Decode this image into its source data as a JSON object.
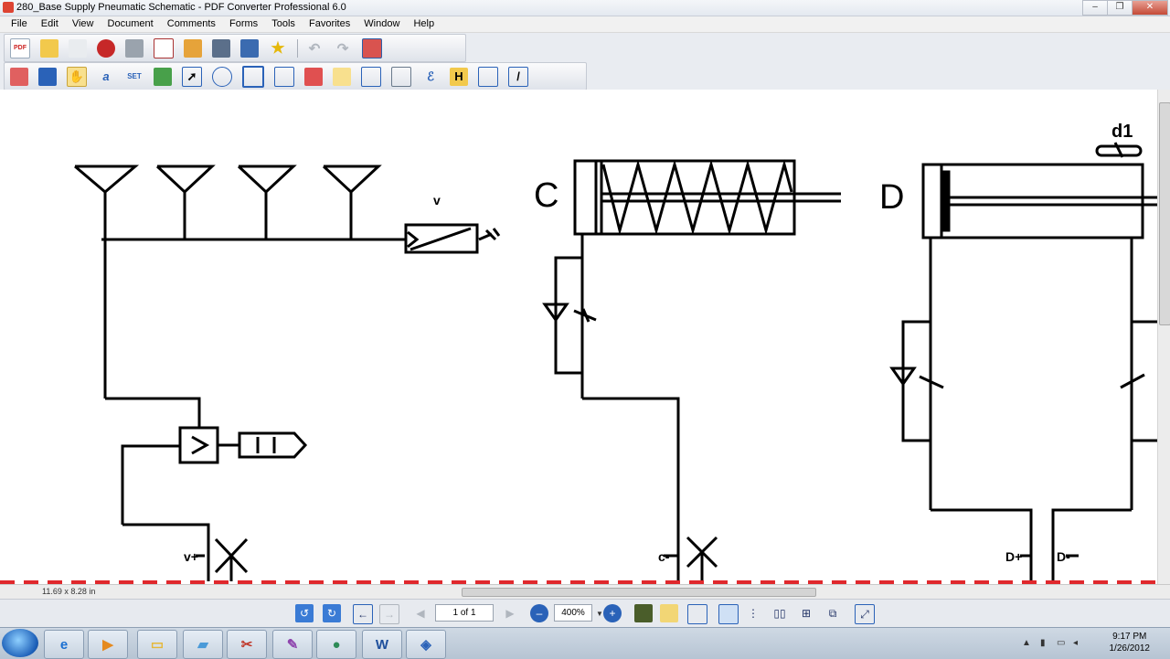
{
  "window": {
    "title": "280_Base Supply Pneumatic Schematic - PDF Converter Professional 6.0",
    "buttons": {
      "minimize": "–",
      "restore": "❐",
      "close": "✕"
    }
  },
  "menu": [
    "File",
    "Edit",
    "View",
    "Document",
    "Comments",
    "Forms",
    "Tools",
    "Favorites",
    "Window",
    "Help"
  ],
  "toolbar1_icons": [
    "new-pdf-icon",
    "open-folder-icon",
    "save-icon",
    "convert-icon",
    "print-icon",
    "email-icon",
    "package-icon",
    "find-icon",
    "search-icon",
    "favorite-star-icon",
    "undo-icon",
    "redo-icon",
    "settings-icon"
  ],
  "toolbar2_icons": [
    "pages-icon",
    "forms-icon",
    "hand-tool-icon",
    "select-text-icon",
    "set-icon",
    "image-icon",
    "arrow-icon",
    "snapshot-icon",
    "crop-icon",
    "edit-text-icon",
    "touchup-icon",
    "highlight-icon",
    "note-icon",
    "text-box-icon",
    "callout-icon",
    "h-icon",
    "cloud-icon",
    "pen-icon"
  ],
  "toolbar2_glyphs": {
    "select": "a",
    "set": "SET",
    "h": "H",
    "pen": "/"
  },
  "schematic": {
    "labels": {
      "v": "v",
      "c": "C",
      "d": "D",
      "d1": "d1",
      "v_plus": "v+",
      "c_minus": "c-",
      "d_plus": "D+",
      "d_minus": "D-"
    },
    "line_color": "#000000",
    "dashed_line_color": "#e0282c"
  },
  "statusbar": {
    "page_size": "11.69 x 8.28 in"
  },
  "navigation": {
    "page_display": "1 of 1",
    "zoom": "400%",
    "glyphs": {
      "prev": "←",
      "next": "→",
      "zoom_out": "–",
      "zoom_in": "+"
    }
  },
  "taskbar": {
    "apps": [
      "ie-icon",
      "media-icon",
      "explorer-icon",
      "notes-icon",
      "snipping-icon",
      "paint-icon",
      "network-icon",
      "word-icon",
      "pdf-converter-icon"
    ],
    "word_glyph": "W",
    "time": "9:17 PM",
    "date": "1/26/2012"
  }
}
